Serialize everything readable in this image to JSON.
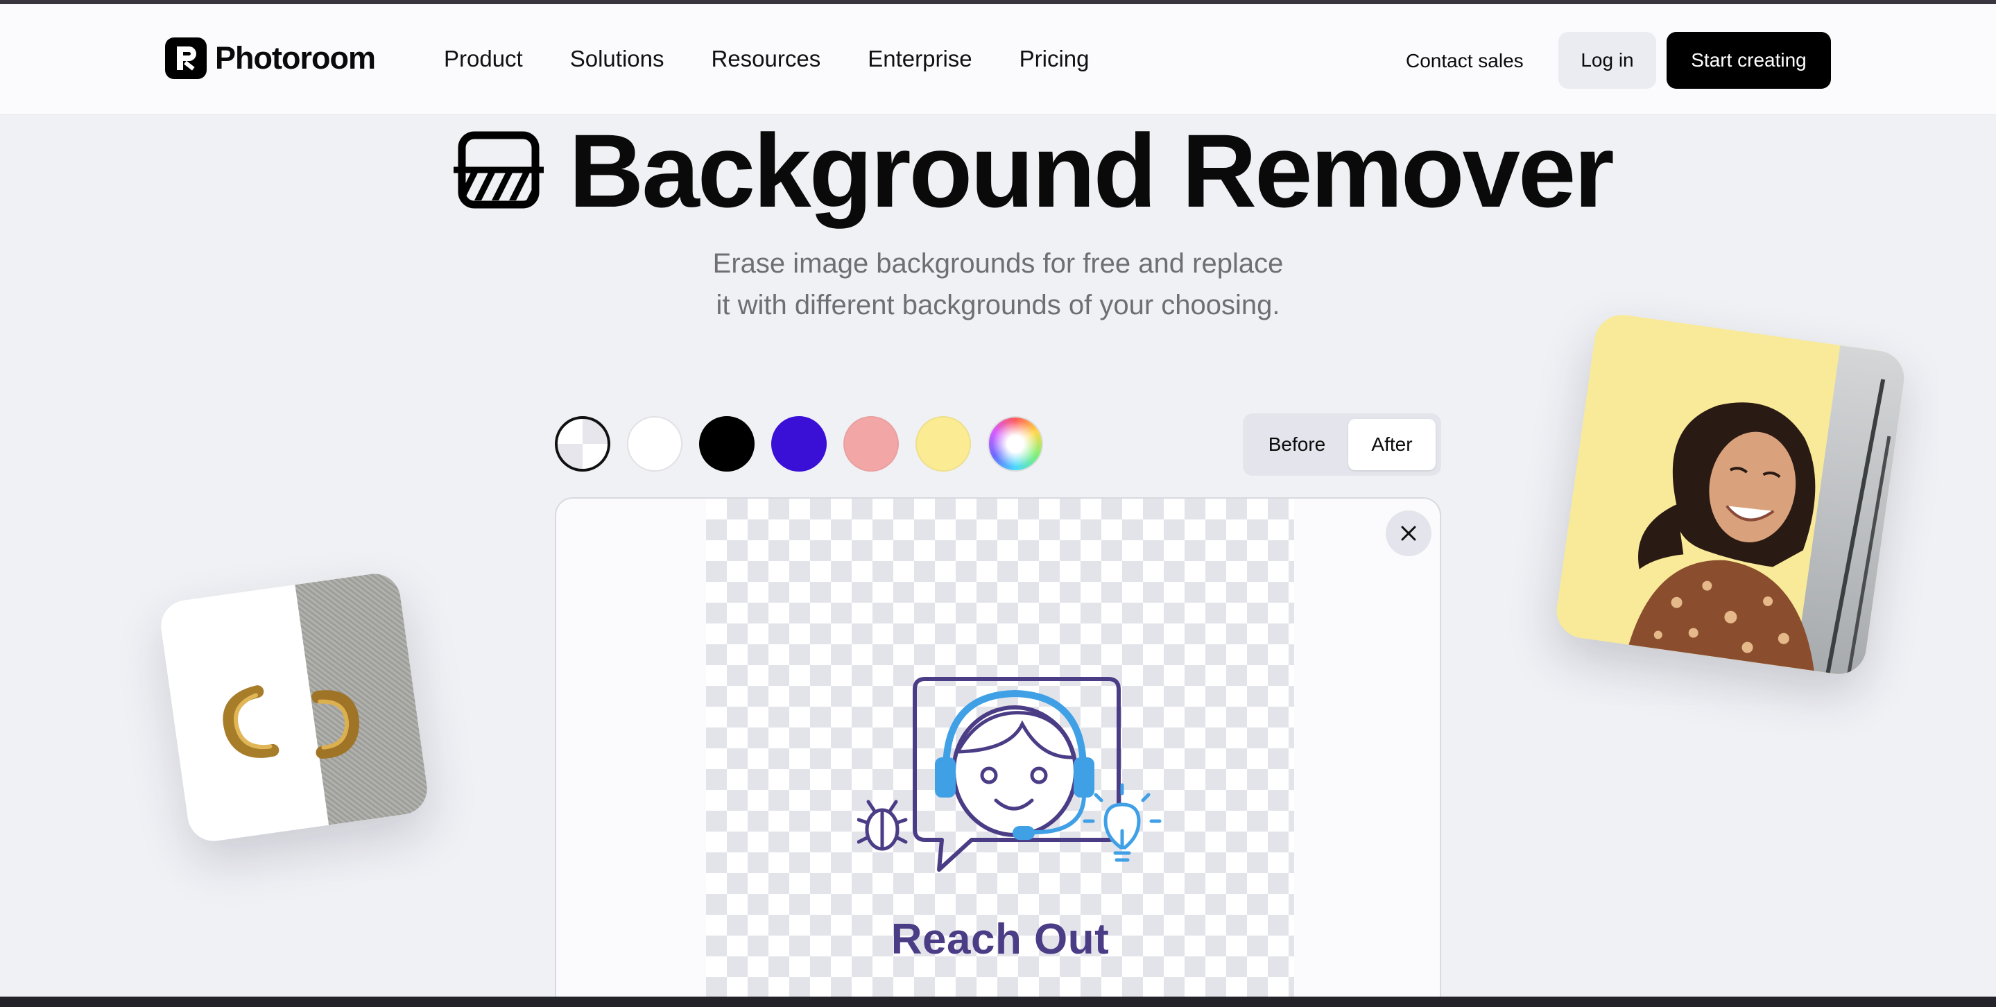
{
  "nav": {
    "logo_text": "Photoroom",
    "menu": [
      "Product",
      "Solutions",
      "Resources",
      "Enterprise",
      "Pricing"
    ],
    "contact_sales": "Contact sales",
    "log_in": "Log in",
    "start_creating": "Start creating"
  },
  "hero": {
    "title": "Background Remover",
    "subtitle_line1": "Erase image backgrounds for free and replace",
    "subtitle_line2": "it with different backgrounds of your choosing."
  },
  "swatches": [
    {
      "name": "transparent",
      "color": "transparent"
    },
    {
      "name": "white",
      "color": "#ffffff"
    },
    {
      "name": "black",
      "color": "#000000"
    },
    {
      "name": "indigo",
      "color": "#3a0fd6"
    },
    {
      "name": "pink",
      "color": "#f2a7a6"
    },
    {
      "name": "yellow",
      "color": "#fbeb92"
    },
    {
      "name": "rainbow",
      "color": "gradient"
    }
  ],
  "toggle": {
    "before_label": "Before",
    "after_label": "After",
    "selected": "After"
  },
  "editor": {
    "image_caption": "Reach Out",
    "illustration": "support-agent-headset-icon",
    "close_icon": "close-icon"
  },
  "colors": {
    "accent_purple": "#4b3c86",
    "illustration_blue": "#3fa0e6",
    "page_background": "#f0f1f5"
  }
}
